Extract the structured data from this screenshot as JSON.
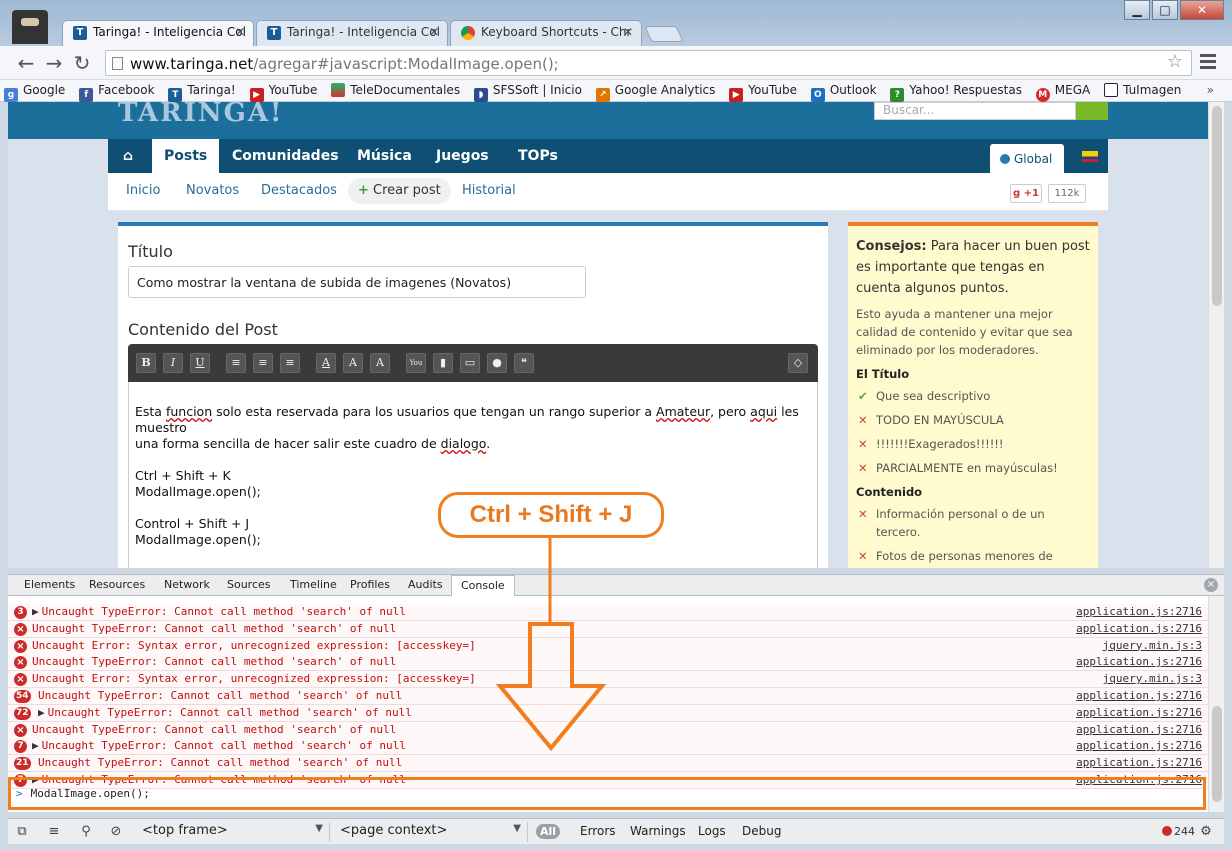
{
  "browser": {
    "tabs": [
      {
        "title": "Taringa! - Inteligencia Col",
        "favicon": "T"
      },
      {
        "title": "Taringa! - Inteligencia Col",
        "favicon": "T"
      },
      {
        "title": "Keyboard Shortcuts - Chr",
        "favicon": "chrome"
      }
    ],
    "url_host": "www.taringa.net",
    "url_path": "/agregar#javascript:ModalImage.open();",
    "bookmarks": [
      "Google",
      "Facebook",
      "Taringa!",
      "YouTube",
      "TeleDocumentales",
      "SFSSoft | Inicio",
      "Google Analytics",
      "YouTube",
      "Outlook",
      "Yahoo! Respuestas",
      "MEGA",
      "TuImagen"
    ],
    "bookmarks_more": "»"
  },
  "site": {
    "search_placeholder": "Buscar...",
    "nav": [
      "Posts",
      "Comunidades",
      "Música",
      "Juegos",
      "TOPs"
    ],
    "global_label": "Global",
    "subnav": [
      "Inicio",
      "Novatos",
      "Destacados",
      "Crear post",
      "Historial"
    ],
    "gplus_label": "+1",
    "gplus_count": "112k"
  },
  "form": {
    "title_label": "Título",
    "title_value": "Como mostrar la ventana de subida de imagenes (Novatos)",
    "content_label": "Contenido del Post",
    "editor_buttons": [
      "B",
      "I",
      "U",
      "≡",
      "≡",
      "≡",
      "A",
      "A",
      "A",
      "You",
      "",
      "",
      "",
      "",
      ""
    ],
    "para1_a": "Esta ",
    "para1_w1": "funcion",
    "para1_b": " solo esta reservada para los usuarios que tengan un rango superior a ",
    "para1_w2": "Amateur",
    "para1_c": ", pero ",
    "para1_w3": "aqui",
    "para1_d": " les muestro",
    "para1_e": "una forma sencilla de hacer salir este cuadro de ",
    "para1_w4": "dialogo",
    "para1_f": ".",
    "line1": "Ctrl + Shift + K",
    "line2": "ModalImage.open();",
    "line3": "Control + Shift + J",
    "line4": "ModalImage.open();"
  },
  "tips": {
    "head_bold": "Consejos:",
    "head_text": " Para hacer un buen post es importante que tengas en cuenta algunos puntos.",
    "small": "Esto ayuda a mantener una mejor calidad de contenido y evitar que sea eliminado por los moderadores.",
    "sec1": "El Título",
    "rows1": [
      {
        "ok": true,
        "text": "Que sea descriptivo"
      },
      {
        "ok": false,
        "text": "TODO EN MAYÚSCULA"
      },
      {
        "ok": false,
        "text": "!!!!!!!Exagerados!!!!!!"
      },
      {
        "ok": false,
        "text": "PARCIALMENTE en mayúsculas!"
      }
    ],
    "sec2": "Contenido",
    "rows2": [
      {
        "ok": false,
        "text": "Información personal o de un tercero."
      },
      {
        "ok": false,
        "text": "Fotos de personas menores de"
      }
    ]
  },
  "devtools": {
    "tabs": [
      "Elements",
      "Resources",
      "Network",
      "Sources",
      "Timeline",
      "Profiles",
      "Audits",
      "Console"
    ],
    "active_tab": "Console",
    "lines": [
      {
        "badge": "3",
        "expand": true,
        "msg": "Uncaught TypeError: Cannot call method 'search' of null",
        "src": "application.js:2716"
      },
      {
        "badge": "",
        "expand": false,
        "msg": "Uncaught TypeError: Cannot call method 'search' of null",
        "src": "application.js:2716"
      },
      {
        "badge": "",
        "expand": false,
        "msg": "Uncaught Error: Syntax error, unrecognized expression: [accesskey=]",
        "src": "jquery.min.js:3"
      },
      {
        "badge": "",
        "expand": false,
        "msg": "Uncaught TypeError: Cannot call method 'search' of null",
        "src": "application.js:2716"
      },
      {
        "badge": "",
        "expand": false,
        "msg": "Uncaught Error: Syntax error, unrecognized expression: [accesskey=]",
        "src": "jquery.min.js:3"
      },
      {
        "badge": "54",
        "expand": false,
        "msg": "Uncaught TypeError: Cannot call method 'search' of null",
        "src": "application.js:2716"
      },
      {
        "badge": "72",
        "expand": true,
        "msg": "Uncaught TypeError: Cannot call method 'search' of null",
        "src": "application.js:2716"
      },
      {
        "badge": "",
        "expand": false,
        "msg": "Uncaught TypeError: Cannot call method 'search' of null",
        "src": "application.js:2716"
      },
      {
        "badge": "7",
        "expand": true,
        "msg": "Uncaught TypeError: Cannot call method 'search' of null",
        "src": "application.js:2716"
      },
      {
        "badge": "21",
        "expand": false,
        "msg": "Uncaught TypeError: Cannot call method 'search' of null",
        "src": "application.js:2716"
      },
      {
        "badge": "7",
        "expand": true,
        "msg": "Uncaught TypeError: Cannot call method 'search' of null",
        "src": "application.js:2716"
      }
    ],
    "prompt_text": "ModalImage.open();",
    "frame_select": "<top frame>",
    "context_select": "<page context>",
    "filter_all": "All",
    "filters": [
      "Errors",
      "Warnings",
      "Logs",
      "Debug"
    ],
    "error_count": "244"
  },
  "annotation": {
    "text": "Ctrl + Shift + J",
    "color": "#f07d1e"
  }
}
